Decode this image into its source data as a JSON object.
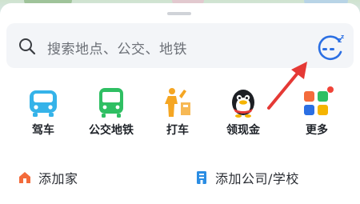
{
  "search": {
    "placeholder": "搜索地点、公交、地铁"
  },
  "shortcuts": [
    {
      "label": "驾车",
      "icon": "car-icon"
    },
    {
      "label": "公交地铁",
      "icon": "bus-icon"
    },
    {
      "label": "打车",
      "icon": "taxi-hail-icon"
    },
    {
      "label": "领现金",
      "icon": "penguin-mascot-icon"
    },
    {
      "label": "更多",
      "icon": "grid-more-icon"
    }
  ],
  "quick_places": {
    "home": {
      "label": "添加家",
      "icon": "home-icon"
    },
    "work": {
      "label": "添加公司/学校",
      "icon": "office-building-icon"
    }
  },
  "colors": {
    "car": "#35b3e9",
    "bus": "#2fbf63",
    "taxi": "#f5a623",
    "accent": "#2b6fe3",
    "home": "#f36b3b",
    "arrow": "#e53935"
  }
}
